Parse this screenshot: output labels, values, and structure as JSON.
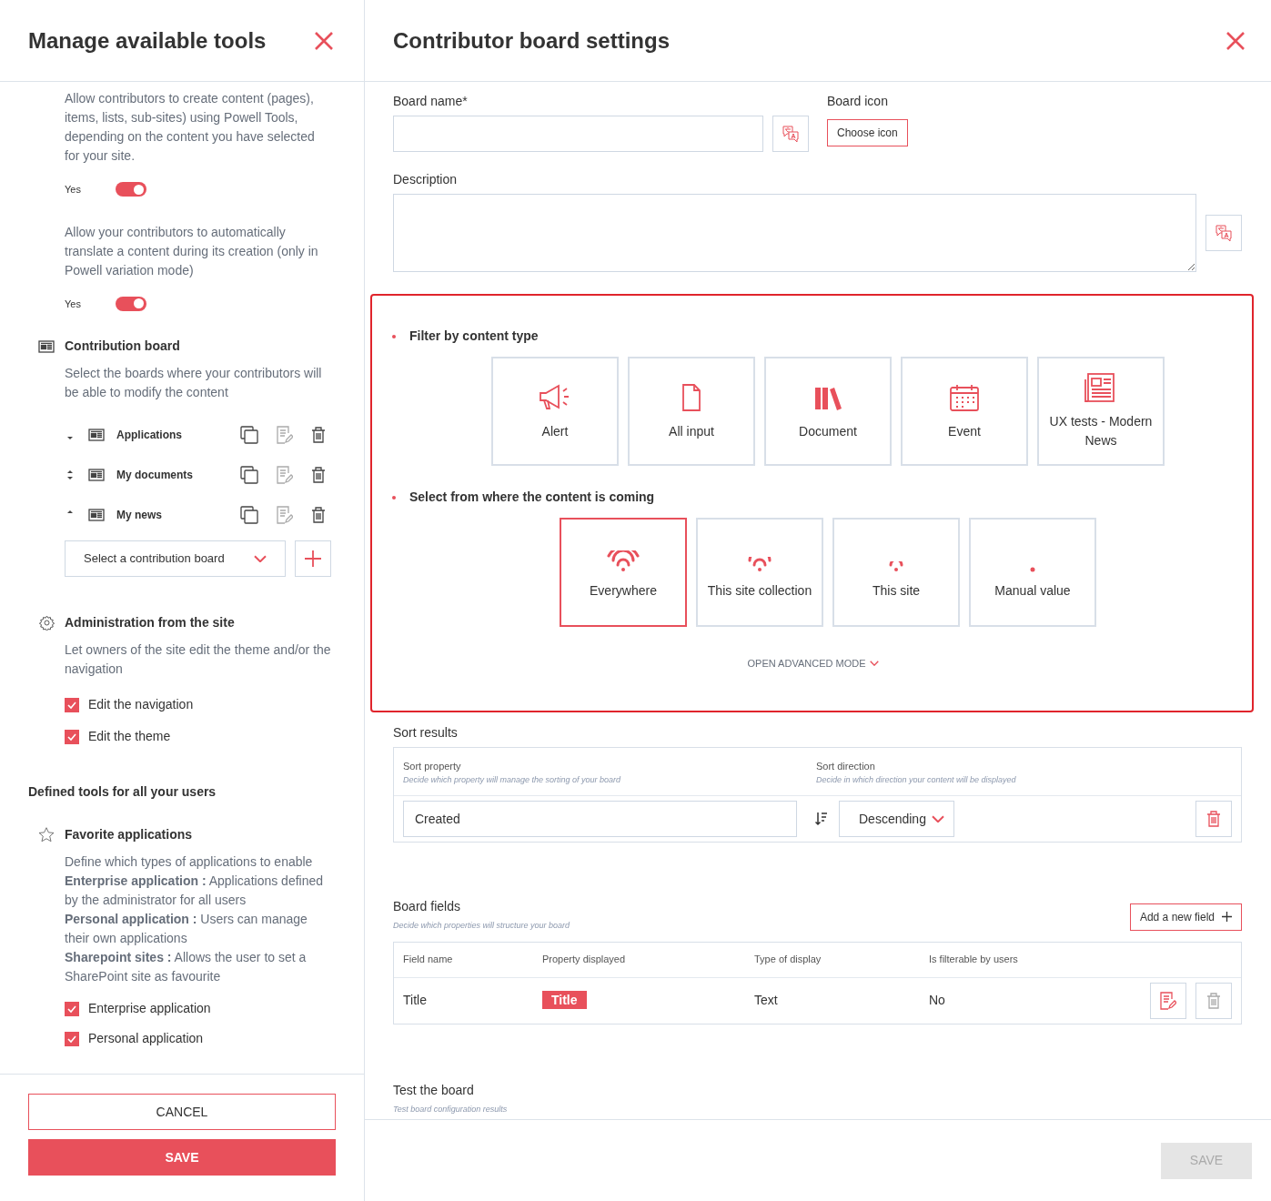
{
  "left_panel": {
    "title": "Manage available tools",
    "intro_paragraphs": [
      {
        "text": "Allow contributors to create content (pages), items, lists, sub-sites) using Powell Tools, depending on the content you have selected for your site.",
        "toggle": {
          "label": "Yes",
          "on": true
        }
      },
      {
        "text": "Allow your contributors to automatically translate a content during its creation (only in Powell variation mode)",
        "toggle": {
          "label": "Yes",
          "on": true
        }
      }
    ],
    "contribution_board": {
      "title": "Contribution board",
      "description": "Select the boards where your contributors will be able to modify the content",
      "boards": [
        {
          "name": "Applications",
          "kind": "first"
        },
        {
          "name": "My documents",
          "kind": "middle"
        },
        {
          "name": "My news",
          "kind": "last"
        }
      ],
      "select": {
        "placeholder": "Select a contribution board"
      }
    },
    "administration": {
      "title": "Administration from the site",
      "description": "Let owners of the site edit the theme and/or the navigation",
      "options": [
        {
          "label": "Edit the navigation",
          "checked": true
        },
        {
          "label": "Edit the theme",
          "checked": true
        }
      ]
    },
    "defined_tools_heading": "Defined tools for all your users",
    "favorite_applications": {
      "title": "Favorite applications",
      "description_lines": [
        "Define which types of applications to enable",
        "**Enterprise application :** Applications defined by the administrator for all users",
        "**Personal application :** Users can manage their own applications",
        "**Sharepoint sites :** Allows the user to set a SharePoint site as favourite"
      ],
      "options": [
        {
          "label": "Enterprise application",
          "checked": true
        },
        {
          "label": "Personal application",
          "checked": true
        }
      ]
    },
    "buttons": {
      "cancel": "CANCEL",
      "save": "SAVE"
    }
  },
  "right_panel": {
    "title": "Contributor board settings",
    "board_name": {
      "label": "Board name*"
    },
    "board_icon": {
      "label": "Board icon",
      "button": "Choose icon"
    },
    "description": {
      "label": "Description"
    },
    "filter": {
      "title": "Filter by content type",
      "content_types": [
        {
          "label": "Alert",
          "kind": "megaphone"
        },
        {
          "label": "All input",
          "kind": "file"
        },
        {
          "label": "Document",
          "kind": "books"
        },
        {
          "label": "Event",
          "kind": "calendar"
        },
        {
          "label": "UX tests - Modern News",
          "kind": "newspaper"
        }
      ]
    },
    "source": {
      "title": "Select from where the content is coming",
      "options": [
        {
          "label": "Everywhere",
          "kind": "wide",
          "selected": true
        },
        {
          "label": "This site collection",
          "kind": "medium",
          "selected": false
        },
        {
          "label": "This site",
          "kind": "narrow",
          "selected": false
        },
        {
          "label": "Manual value",
          "kind": "point",
          "selected": false
        }
      ],
      "advanced": "OPEN ADVANCED MODE"
    },
    "sort": {
      "title": "Sort results",
      "property_label": "Sort property",
      "property_hint": "Decide which property will manage the sorting of your board",
      "direction_label": "Sort direction",
      "direction_hint": "Decide in which direction your content will be displayed",
      "property_value": "Created",
      "direction_value": "Descending"
    },
    "fields": {
      "title": "Board fields",
      "hint": "Decide which properties will structure your board",
      "add_button": "Add a new field",
      "columns": [
        "Field name",
        "Property displayed",
        "Type of display",
        "Is filterable by users"
      ],
      "rows": [
        {
          "field_name": "Title",
          "property": "Title",
          "display": "Text",
          "filterable": "No"
        }
      ]
    },
    "test": {
      "title": "Test the board",
      "hint": "Test board configuration results"
    },
    "save": {
      "label": "SAVE",
      "disabled": true
    }
  }
}
